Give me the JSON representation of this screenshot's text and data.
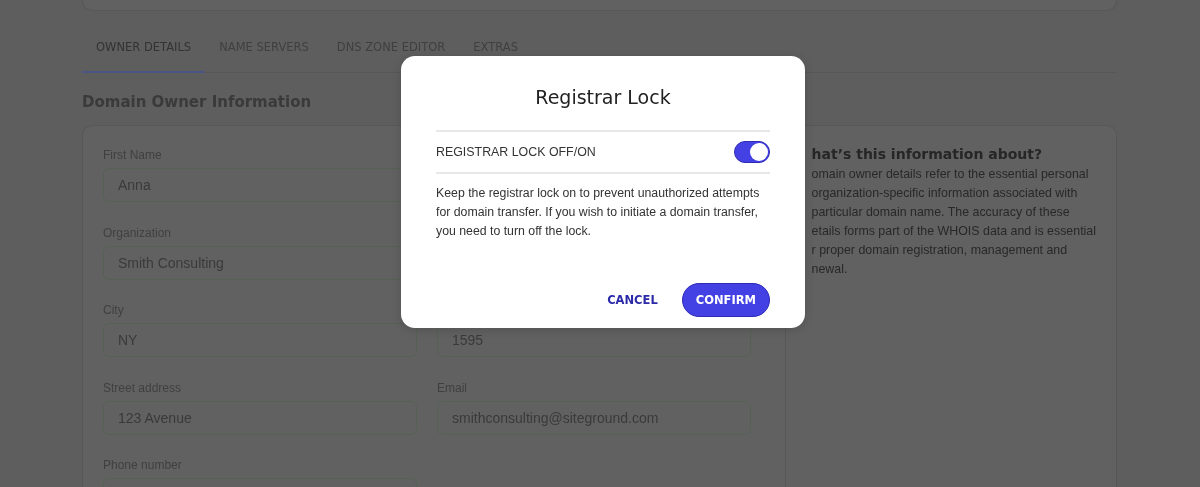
{
  "tabs": [
    {
      "label": "OWNER DETAILS",
      "selected": true
    },
    {
      "label": "NAME SERVERS",
      "selected": false
    },
    {
      "label": "DNS ZONE EDITOR",
      "selected": false
    },
    {
      "label": "EXTRAS",
      "selected": false
    }
  ],
  "section_title": "Domain Owner Information",
  "form_rows": [
    [
      {
        "label": "First Name",
        "value": "Anna"
      }
    ],
    [
      {
        "label": "Organization",
        "value": "Smith Consulting"
      }
    ],
    [
      {
        "label": "City",
        "value": "NY"
      },
      {
        "value": "1595"
      }
    ],
    [
      {
        "label": "Street address",
        "value": "123 Avenue"
      },
      {
        "label": "Email",
        "value": "smithconsulting@siteground.com"
      }
    ],
    [
      {
        "label": "Phone number"
      }
    ]
  ],
  "info": {
    "title": "hat’s this information about?",
    "lines": [
      "omain owner details refer to the essential personal",
      "organization-specific information associated with",
      "particular domain name. The accuracy of these",
      "etails forms part of the WHOIS data and is essential",
      "r proper domain registration, management and",
      "newal."
    ]
  },
  "modal": {
    "title": "Registrar Lock",
    "toggle": {
      "label": "REGISTRAR LOCK OFF/ON",
      "on": true
    },
    "text": "Keep the registrar lock on to prevent unauthorized attempts for domain transfer. If you wish to initiate a domain transfer, you need to turn off the lock.",
    "buttons": [
      {
        "label": "CANCEL",
        "kind": "text"
      },
      {
        "label": "CONFIRM",
        "kind": "primary"
      }
    ]
  }
}
